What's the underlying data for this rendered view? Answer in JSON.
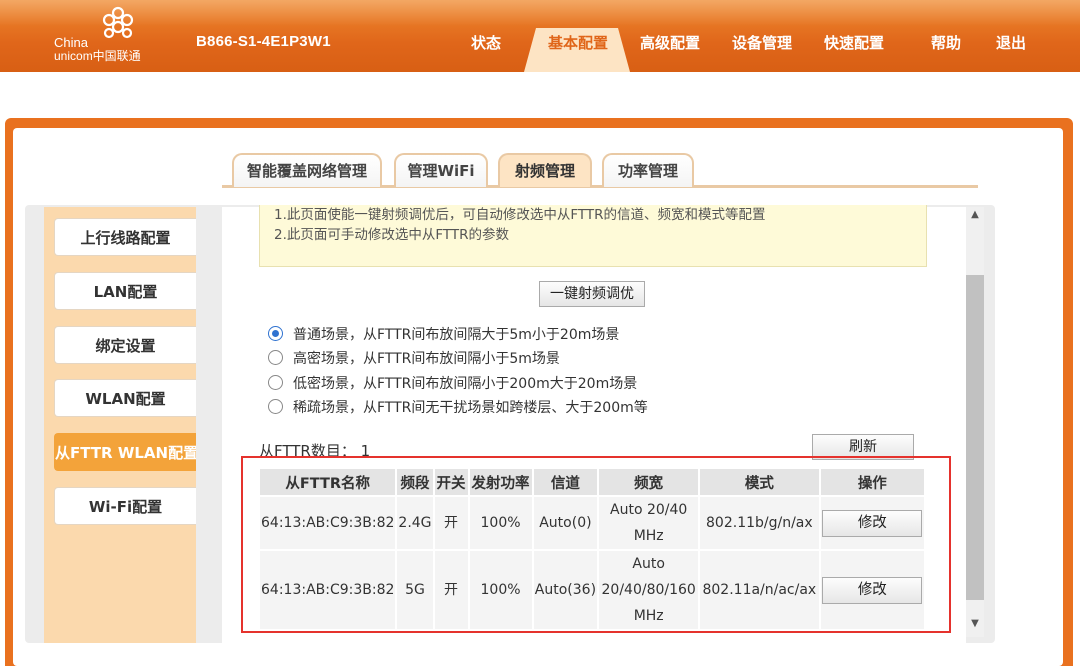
{
  "header": {
    "brand_en": "China",
    "brand_en2": "unicom中国联通",
    "device_model": "B866-S1-4E1P3W1",
    "nav": [
      "状态",
      "基本配置",
      "高级配置",
      "设备管理",
      "快速配置",
      "帮助",
      "退出"
    ],
    "nav_active": "基本配置"
  },
  "subtabs": [
    "智能覆盖网络管理",
    "管理WiFi",
    "射频管理",
    "功率管理"
  ],
  "subtab_active": "射频管理",
  "sidebar": [
    "上行线路配置",
    "LAN配置",
    "绑定设置",
    "WLAN配置",
    "从FTTR WLAN配置",
    "Wi-Fi配置"
  ],
  "sidebar_active": "从FTTR WLAN配置",
  "notes": [
    "1.此页面使能一键射频调优后，可自动修改选中从FTTR的信道、频宽和模式等配置",
    "2.此页面可手动修改选中从FTTR的参数"
  ],
  "one_click_button": "一键射频调优",
  "scenarios": [
    {
      "label": "普通场景，从FTTR间布放间隔大于5m小于20m场景",
      "checked": true
    },
    {
      "label": "高密场景，从FTTR间布放间隔小于5m场景",
      "checked": false
    },
    {
      "label": "低密场景，从FTTR间布放间隔小于200m大于20m场景",
      "checked": false
    },
    {
      "label": "稀疏场景，从FTTR间无干扰场景如跨楼层、大于200m等",
      "checked": false
    }
  ],
  "fttr_count_label": "从FTTR数目：",
  "fttr_count_value": "1",
  "refresh_button": "刷新",
  "table": {
    "headers": [
      "从FTTR名称",
      "频段",
      "开关",
      "发射功率",
      "信道",
      "频宽",
      "模式",
      "操作"
    ],
    "rows": [
      {
        "name": "64:13:AB:C9:3B:82",
        "band": "2.4G",
        "switch": "开",
        "power": "100%",
        "channel": "Auto(0)",
        "bandwidth_l1": "Auto 20/40",
        "bandwidth_l2": "MHz",
        "bandwidth_l3": "",
        "mode": "802.11b/g/n/ax",
        "action": "修改"
      },
      {
        "name": "64:13:AB:C9:3B:82",
        "band": "5G",
        "switch": "开",
        "power": "100%",
        "channel": "Auto(36)",
        "bandwidth_l1": "Auto",
        "bandwidth_l2": "20/40/80/160",
        "bandwidth_l3": "MHz",
        "mode": "802.11a/n/ac/ax",
        "action": "修改"
      }
    ]
  },
  "colors": {
    "header_orange": "#e0661a",
    "active_tab_bg": "#fde4c4",
    "sidebar_bg": "#fbd9ad",
    "sidebar_active": "#f3a33a",
    "note_bg": "#fefad8",
    "highlight_border": "#e5322d"
  },
  "icons": {
    "logo": "china-unicom-knot-logo",
    "scroll_up": "triangle-up-icon",
    "scroll_down": "triangle-down-icon"
  }
}
